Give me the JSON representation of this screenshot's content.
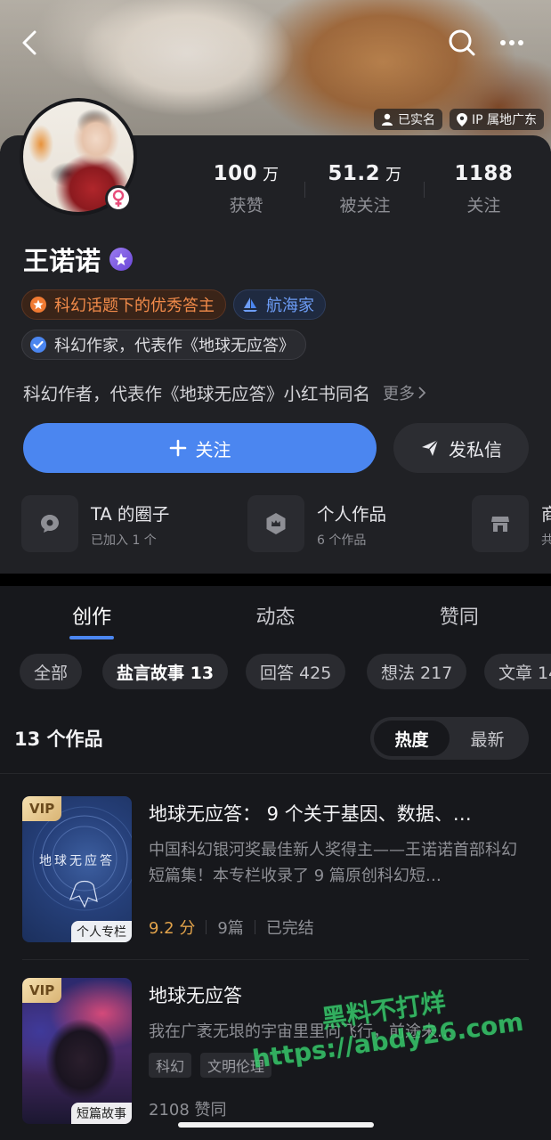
{
  "cover": {
    "verified": "已实名",
    "ip": "IP 属地广东"
  },
  "stats": [
    {
      "num": "100",
      "unit": "万",
      "label": "获赞"
    },
    {
      "num": "51.2",
      "unit": "万",
      "label": "被关注"
    },
    {
      "num": "1188",
      "unit": "",
      "label": "关注"
    }
  ],
  "profile": {
    "name": "王诺诺",
    "badge_excellent": "科幻话题下的优秀答主",
    "badge_navigator": "航海家",
    "badge_writer": "科幻作家，代表作《地球无应答》",
    "bio": "科幻作者，代表作《地球无应答》小红书同名",
    "bio_more": "更多"
  },
  "actions": {
    "follow": "关注",
    "message": "发私信"
  },
  "shortcuts": [
    {
      "title": "TA 的圈子",
      "sub": "已加入 1 个"
    },
    {
      "title": "个人作品",
      "sub": "6 个作品"
    },
    {
      "title": "商",
      "sub": "共"
    }
  ],
  "tabs": [
    "创作",
    "动态",
    "赞同"
  ],
  "chips": [
    "全部",
    "盐言故事 13",
    "回答 425",
    "想法 217",
    "文章 14"
  ],
  "list_header": {
    "count": "13 个作品",
    "sort_hot": "热度",
    "sort_new": "最新"
  },
  "items": [
    {
      "vip": "VIP",
      "cover_text": "地球无应答",
      "corner": "个人专栏",
      "title": "地球无应答： 9 个关于基因、数据、…",
      "desc": "中国科幻银河奖最佳新人奖得主——王诺诺首部科幻短篇集！本专栏收录了 9 篇原创科幻短…",
      "score": "9.2 分",
      "parts": "9篇",
      "status": "已完结"
    },
    {
      "vip": "VIP",
      "corner": "短篇故事",
      "title": "地球无应答",
      "desc": "我在广袤无垠的宇宙里里向飞行，前途未…",
      "tags": [
        "科幻",
        "文明伦理"
      ],
      "likes": "2108 赞同"
    }
  ],
  "watermark": {
    "line1": "黑料不打烊",
    "line2": "https://abdy26.com"
  }
}
